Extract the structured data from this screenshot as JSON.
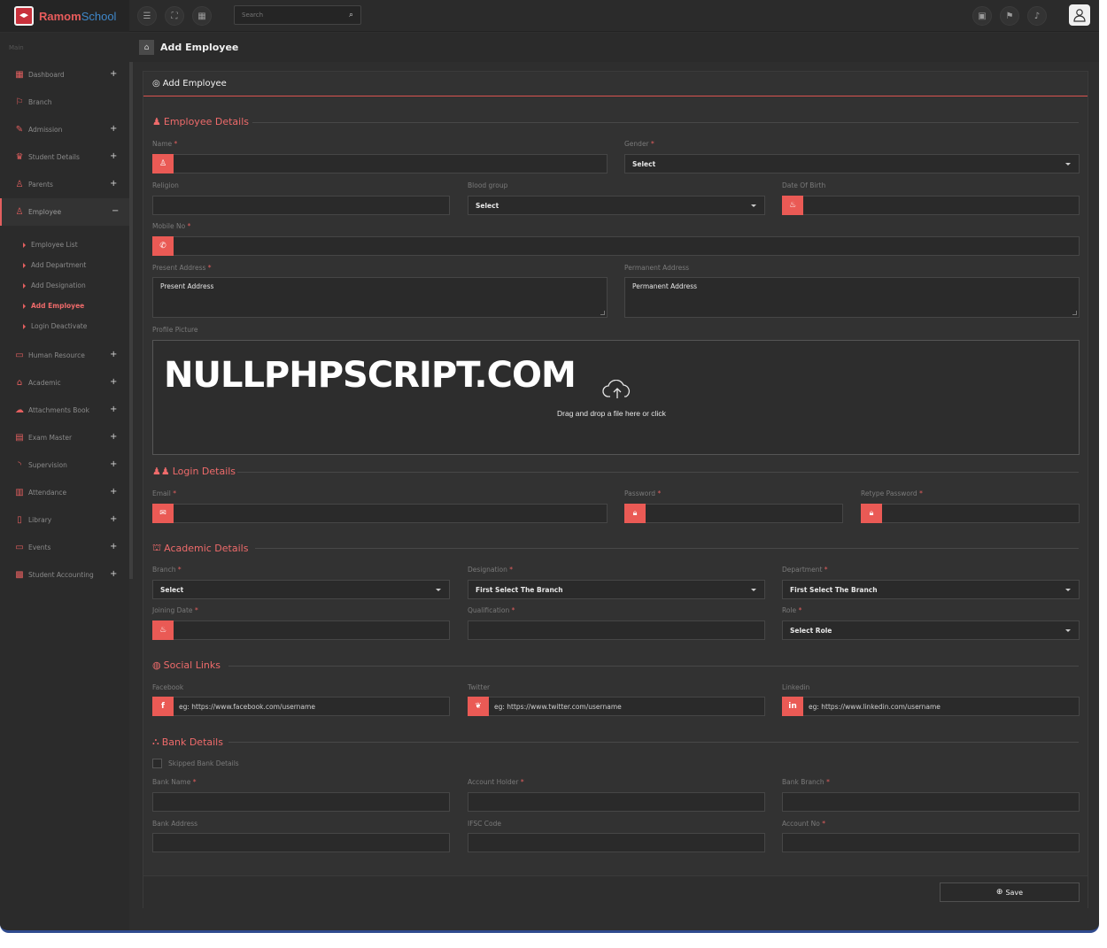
{
  "app": {
    "brand_a": "Ramom",
    "brand_b": "School"
  },
  "topbar": {
    "search_placeholder": "Search"
  },
  "page": {
    "title": "Add Employee"
  },
  "sidebar": {
    "section": "Main",
    "items": [
      {
        "label": "Dashboard"
      },
      {
        "label": "Branch"
      },
      {
        "label": "Admission"
      },
      {
        "label": "Student Details"
      },
      {
        "label": "Parents"
      },
      {
        "label": "Employee"
      },
      {
        "label": "Human Resource"
      },
      {
        "label": "Academic"
      },
      {
        "label": "Attachments Book"
      },
      {
        "label": "Exam Master"
      },
      {
        "label": "Supervision"
      },
      {
        "label": "Attendance"
      },
      {
        "label": "Library"
      },
      {
        "label": "Events"
      },
      {
        "label": "Student Accounting"
      }
    ],
    "sub": [
      "Employee List",
      "Add Department",
      "Add Designation",
      "Add Employee",
      "Login Deactivate"
    ]
  },
  "card": {
    "title": "Add Employee"
  },
  "employee": {
    "title": "Employee Details",
    "name": "Name",
    "gender": "Gender",
    "select": "Select",
    "religion": "Religion",
    "blood_group": "Blood group",
    "dob": "Date Of Birth",
    "mobile": "Mobile No",
    "present": "Present Address",
    "permanent": "Permanent Address",
    "present_ph": "Present Address",
    "permanent_ph": "Permanent Address",
    "profile": "Profile Picture",
    "drop": "Drag and drop a file here or click",
    "watermark": "NULLPHPSCRIPT.COM"
  },
  "login": {
    "title": "Login Details",
    "email": "Email",
    "password": "Password",
    "retype": "Retype Password"
  },
  "academic": {
    "title": "Academic Details",
    "branch": "Branch",
    "designation": "Designation",
    "department": "Department",
    "branch_val": "Select",
    "designation_val": "First Select The Branch",
    "department_val": "First Select The Branch",
    "joining": "Joining Date",
    "qualification": "Qualification",
    "role": "Role",
    "role_val": "Select Role"
  },
  "social": {
    "title": "Social Links",
    "facebook": "Facebook",
    "twitter": "Twitter",
    "linkedin": "Linkedin",
    "fb_ph": "eg: https://www.facebook.com/username",
    "tw_ph": "eg: https://www.twitter.com/username",
    "li_ph": "eg: https://www.linkedin.com/username"
  },
  "bank": {
    "title": "Bank Details",
    "skip": "Skipped Bank Details",
    "bank_name": "Bank Name",
    "holder": "Account Holder",
    "branch": "Bank Branch",
    "address": "Bank Address",
    "ifsc": "IFSC Code",
    "acct": "Account No"
  },
  "footer": {
    "save": "Save"
  },
  "colors": {
    "accent": "#ea5a55",
    "bg": "#2e2e2e"
  }
}
